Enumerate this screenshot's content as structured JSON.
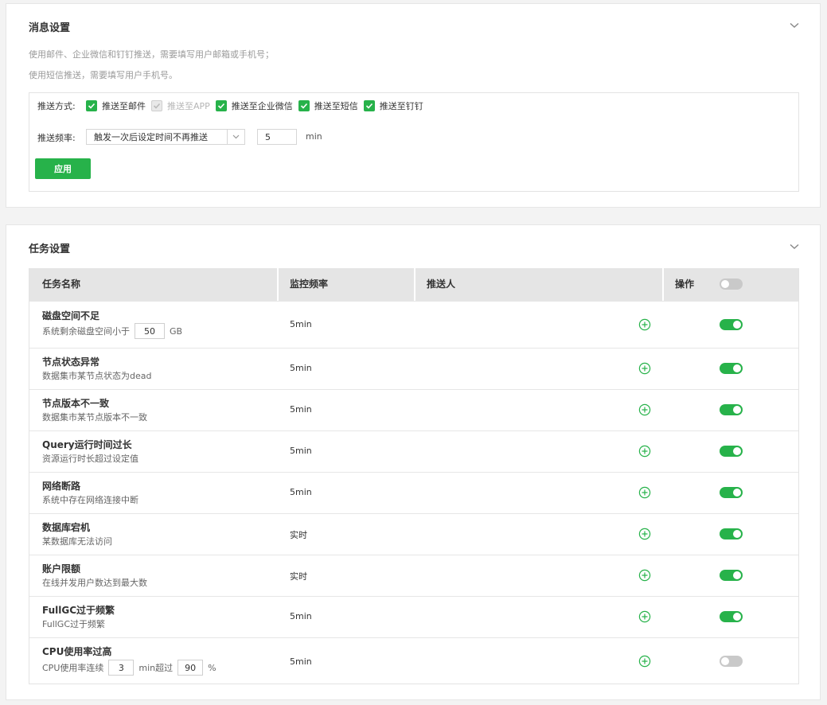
{
  "message_settings": {
    "title": "消息设置",
    "desc_line1": "使用邮件、企业微信和钉钉推送，需要填写用户邮箱或手机号；",
    "desc_line2": "使用短信推送，需要填写用户手机号。",
    "push_method_label": "推送方式:",
    "push_options": [
      {
        "label": "推送至邮件",
        "checked": true,
        "disabled": false
      },
      {
        "label": "推送至APP",
        "checked": true,
        "disabled": true
      },
      {
        "label": "推送至企业微信",
        "checked": true,
        "disabled": false
      },
      {
        "label": "推送至短信",
        "checked": true,
        "disabled": false
      },
      {
        "label": "推送至钉钉",
        "checked": true,
        "disabled": false
      }
    ],
    "push_frequency_label": "推送频率:",
    "frequency_select_value": "触发一次后设定时间不再推送",
    "frequency_value": "5",
    "frequency_unit": "min",
    "apply_label": "应用"
  },
  "task_settings": {
    "title": "任务设置",
    "columns": {
      "name": "任务名称",
      "frequency": "监控频率",
      "recipient": "推送人",
      "action": "操作"
    },
    "header_toggle_on": false,
    "rows": [
      {
        "name": "磁盘空间不足",
        "desc_pre": "系统剩余磁盘空间小于",
        "input1": "50",
        "desc_mid": "GB",
        "frequency": "5min",
        "enabled": true
      },
      {
        "name": "节点状态异常",
        "desc": "数据集市某节点状态为dead",
        "frequency": "5min",
        "enabled": true
      },
      {
        "name": "节点版本不一致",
        "desc": "数据集市某节点版本不一致",
        "frequency": "5min",
        "enabled": true
      },
      {
        "name": "Query运行时间过长",
        "desc": "资源运行时长超过设定值",
        "frequency": "5min",
        "enabled": true
      },
      {
        "name": "网络断路",
        "desc": "系统中存在网络连接中断",
        "frequency": "5min",
        "enabled": true
      },
      {
        "name": "数据库宕机",
        "desc": "某数据库无法访问",
        "frequency": "实时",
        "enabled": true
      },
      {
        "name": "账户限额",
        "desc": "在线并发用户数达到最大数",
        "frequency": "实时",
        "enabled": true
      },
      {
        "name": "FullGC过于频繁",
        "desc": "FullGC过于频繁",
        "frequency": "5min",
        "enabled": true
      },
      {
        "name": "CPU使用率过高",
        "desc_pre": "CPU使用率连续",
        "input1": "3",
        "desc_mid": "min超过",
        "input2": "90",
        "desc_post": "%",
        "frequency": "5min",
        "enabled": false
      }
    ]
  },
  "colors": {
    "accent": "#27b24a",
    "header_bg": "#e5e5e5",
    "toggle_off": "#c9c9c9"
  }
}
